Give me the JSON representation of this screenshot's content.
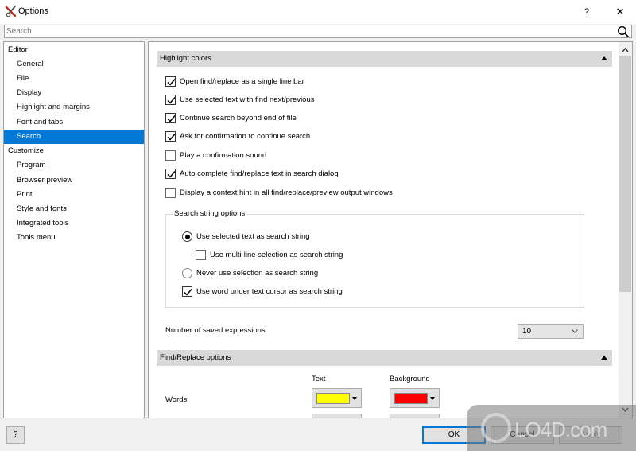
{
  "window": {
    "title": "Options",
    "help_label": "?",
    "close_label": "✕",
    "icon": "tools-icon"
  },
  "search": {
    "placeholder": "Search",
    "value": "",
    "icon": "search-icon"
  },
  "sidebar": {
    "items": [
      {
        "label": "Editor",
        "level": "category",
        "selected": false
      },
      {
        "label": "General",
        "level": "sub",
        "selected": false
      },
      {
        "label": "File",
        "level": "sub",
        "selected": false
      },
      {
        "label": "Display",
        "level": "sub",
        "selected": false
      },
      {
        "label": "Highlight and margins",
        "level": "sub",
        "selected": false
      },
      {
        "label": "Font and tabs",
        "level": "sub",
        "selected": false
      },
      {
        "label": "Search",
        "level": "sub",
        "selected": true
      },
      {
        "label": "Customize",
        "level": "category",
        "selected": false
      },
      {
        "label": "Program",
        "level": "sub",
        "selected": false
      },
      {
        "label": "Browser preview",
        "level": "sub",
        "selected": false
      },
      {
        "label": "Print",
        "level": "sub",
        "selected": false
      },
      {
        "label": "Style and fonts",
        "level": "sub",
        "selected": false
      },
      {
        "label": "Integrated tools",
        "level": "sub",
        "selected": false
      },
      {
        "label": "Tools menu",
        "level": "sub",
        "selected": false
      }
    ]
  },
  "main": {
    "section1": {
      "title": "Highlight colors",
      "checkboxes": [
        {
          "label": "Open find/replace as a single line bar",
          "checked": true
        },
        {
          "label": "Use selected text with find next/previous",
          "checked": true
        },
        {
          "label": "Continue search beyond end of file",
          "checked": true
        },
        {
          "label": "Ask for confirmation to continue search",
          "checked": true
        },
        {
          "label": "Play a confirmation sound",
          "checked": false
        },
        {
          "label": "Auto complete find/replace text in search dialog",
          "checked": true
        },
        {
          "label": "Display a context hint in all find/replace/preview output windows",
          "checked": false
        }
      ],
      "search_string_group": {
        "title": "Search string options",
        "radio_selected": {
          "label": "Use selected text as search string",
          "selected": true
        },
        "multiline": {
          "label": "Use multi-line selection as search string",
          "checked": false
        },
        "radio_never": {
          "label": "Never use selection as search string",
          "selected": false
        },
        "word_under_cursor": {
          "label": "Use word under text cursor as search string",
          "checked": true
        }
      },
      "saved_expressions": {
        "label": "Number of saved expressions",
        "value": "10"
      }
    },
    "section2": {
      "title": "Find/Replace options",
      "col_text": "Text",
      "col_background": "Background",
      "rows": [
        {
          "label": "Words",
          "text_color": "#ffff00",
          "background_color": "#ff0000"
        }
      ]
    }
  },
  "footer": {
    "help": "?",
    "ok": "OK",
    "cancel": "Cancel",
    "apply": "Apply"
  },
  "watermark": {
    "text": "LO4D.com"
  }
}
